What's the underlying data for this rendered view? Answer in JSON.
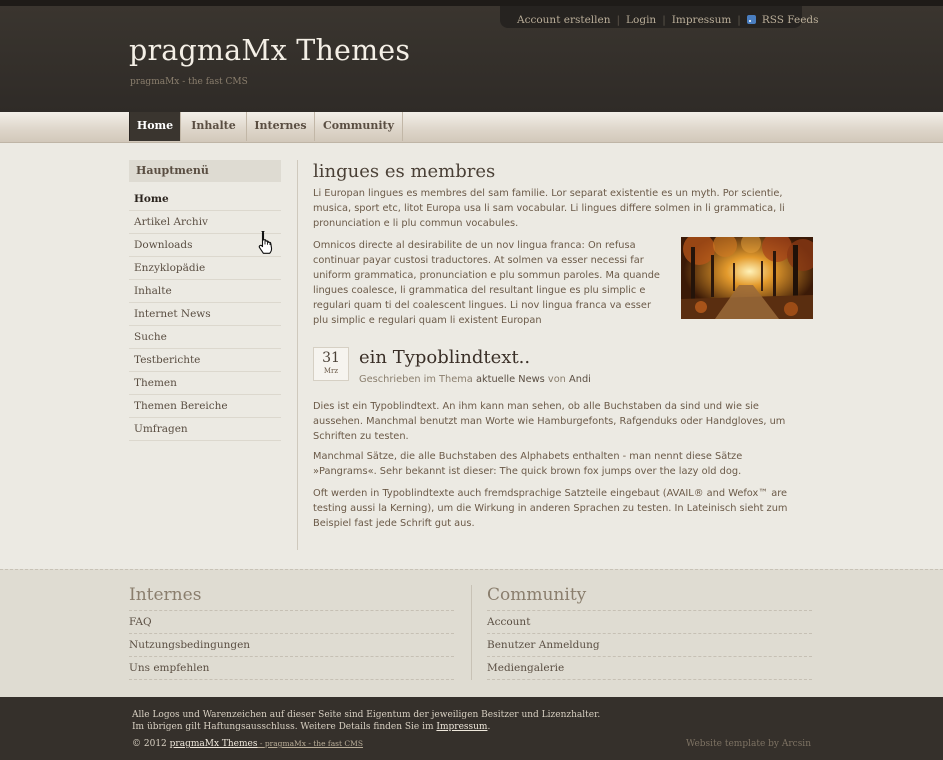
{
  "header": {
    "site_title": "pragmaMx Themes",
    "slogan": "pragmaMx - the fast CMS",
    "toplinks": {
      "account": "Account erstellen",
      "login": "Login",
      "impressum": "Impressum",
      "rss": "RSS Feeds"
    }
  },
  "nav": {
    "home": "Home",
    "inhalte": "Inhalte",
    "internes": "Internes",
    "community": "Community"
  },
  "sidebar": {
    "title": "Hauptmenü",
    "items": [
      "Home",
      "Artikel Archiv",
      "Downloads",
      "Enzyklopädie",
      "Inhalte",
      "Internet News",
      "Suche",
      "Testberichte",
      "Themen",
      "Themen Bereiche",
      "Umfragen"
    ]
  },
  "main": {
    "heading": "lingues es membres",
    "intro": "Li Europan lingues es membres del sam familie. Lor separat existentie es un myth. Por scientie, musica, sport etc, litot Europa usa li sam vocabular. Li lingues differe solmen in li grammatica, li pronunciation e li plu commun vocabules.",
    "para2": "Omnicos directe al desirabilite de un nov lingua franca: On refusa continuar payar custosi traductores. At solmen va esser necessi far uniform grammatica, pronunciation e plu sommun paroles. Ma quande lingues coalesce, li grammatica del resultant lingue es plu simplic e regulari quam ti del coalescent lingues. Li nov lingua franca va esser plu simplic e regulari quam li existent Europan",
    "article": {
      "day": "31",
      "month": "Mrz",
      "title": "ein Typoblindtext..",
      "by_prefix": "Geschrieben im Thema",
      "topic": "aktuelle News",
      "by_word": "von",
      "author": "Andi",
      "p1": "Dies ist ein Typoblindtext. An ihm kann man sehen, ob alle Buchstaben da sind und wie sie aussehen. Manchmal benutzt man Worte wie Hamburgefonts, Rafgenduks oder Handgloves, um Schriften zu testen.",
      "p2": "Manchmal Sätze, die alle Buchstaben des Alphabets enthalten - man nennt diese Sätze »Pangrams«. Sehr bekannt ist dieser: The quick brown fox jumps over the lazy old dog.",
      "p3": "Oft werden in Typoblindtexte auch fremdsprachige Satzteile eingebaut (AVAIL® and Wefox™ are testing aussi la Kerning), um die Wirkung in anderen Sprachen zu testen. In Lateinisch sieht zum Beispiel fast jede Schrift gut aus."
    }
  },
  "footer": {
    "col1": {
      "title": "Internes",
      "items": [
        "FAQ",
        "Nutzungsbedingungen",
        "Uns empfehlen"
      ]
    },
    "col2": {
      "title": "Community",
      "items": [
        "Account",
        "Benutzer Anmeldung",
        "Mediengalerie"
      ]
    },
    "legal1": "Alle Logos und Warenzeichen auf dieser Seite sind Eigentum der jeweiligen Besitzer und Lizenzhalter.",
    "legal2": "Im übrigen gilt Haftungsausschluss. Weitere Details finden Sie im",
    "legal_link": "Impressum",
    "legal_end": ".",
    "copy": "© 2012",
    "copy_title": "pragmaMx Themes",
    "copy_dash": " - ",
    "copy_slogan": "pragmaMx - the fast CMS",
    "credit": "Website template by Arcsin"
  }
}
